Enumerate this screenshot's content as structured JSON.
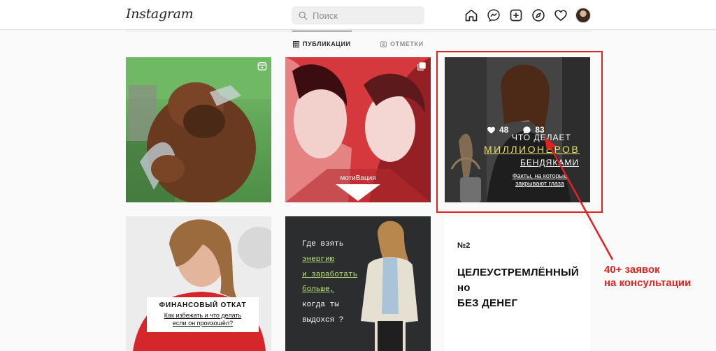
{
  "header": {
    "logo": "Instagram",
    "search_placeholder": "Поиск",
    "nav_icons": [
      "home-icon",
      "messenger-icon",
      "new-post-icon",
      "explore-icon",
      "heart-icon",
      "profile-avatar"
    ]
  },
  "tabs": [
    {
      "label": "ПУБЛИКАЦИИ",
      "active": true,
      "icon": "grid-icon"
    },
    {
      "label": "ОТМЕТКИ",
      "active": false,
      "icon": "tag-icon"
    }
  ],
  "posts": [
    {
      "type": "reel",
      "icon": "reel-icon"
    },
    {
      "type": "carousel",
      "icon": "carousel-icon",
      "caption": "мотиВация"
    },
    {
      "type": "photo",
      "likes": "48",
      "comments": "83",
      "title_line1": "ЧТО ДЕЛАЕТ",
      "title_line2": "МИЛЛИОНЕРОВ",
      "title_line3": "БЕНДЯКАМИ",
      "subtitle_line1": "Факты, на которые",
      "subtitle_line2": "закрывают глаза"
    },
    {
      "type": "photo",
      "title": "ФИНАНСОВЫЙ ОТКАТ",
      "subtitle_line1": "Как избежать и что делать",
      "subtitle_line2": "если он произошёл?"
    },
    {
      "type": "photo",
      "lines": [
        {
          "text": "Где взять",
          "style": "w"
        },
        {
          "text": "энергию",
          "style": "g"
        },
        {
          "text": "и заработать",
          "style": "g"
        },
        {
          "text": "больше,",
          "style": "g"
        },
        {
          "text": "когда ты",
          "style": "w"
        },
        {
          "text": "выдохся ?",
          "style": "w"
        }
      ]
    },
    {
      "type": "text",
      "number": "№2",
      "line1": "ЦЕЛЕУСТРЕМЛЁННЫЙ",
      "line2": "но",
      "line3": "БЕЗ ДЕНЕГ"
    }
  ],
  "annotation": {
    "line1": "40+ заявок",
    "line2": "на консультации",
    "color": "#e3221f"
  }
}
